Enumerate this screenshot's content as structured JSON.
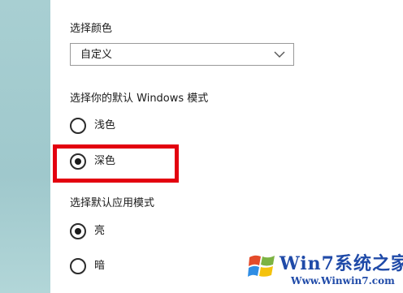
{
  "color_section": {
    "label": "选择颜色",
    "dropdown_value": "自定义"
  },
  "windows_mode": {
    "label": "选择你的默认 Windows 模式",
    "options": [
      {
        "label": "浅色",
        "selected": false
      },
      {
        "label": "深色",
        "selected": true
      }
    ]
  },
  "app_mode": {
    "label": "选择默认应用模式",
    "options": [
      {
        "label": "亮",
        "selected": true
      },
      {
        "label": "暗",
        "selected": false
      }
    ]
  },
  "watermark": {
    "brand": "Win7系统之家",
    "url": "Www.Winwin7.com"
  },
  "colors": {
    "highlight": "#e3000f",
    "side_strip": "#a8cfd2"
  }
}
